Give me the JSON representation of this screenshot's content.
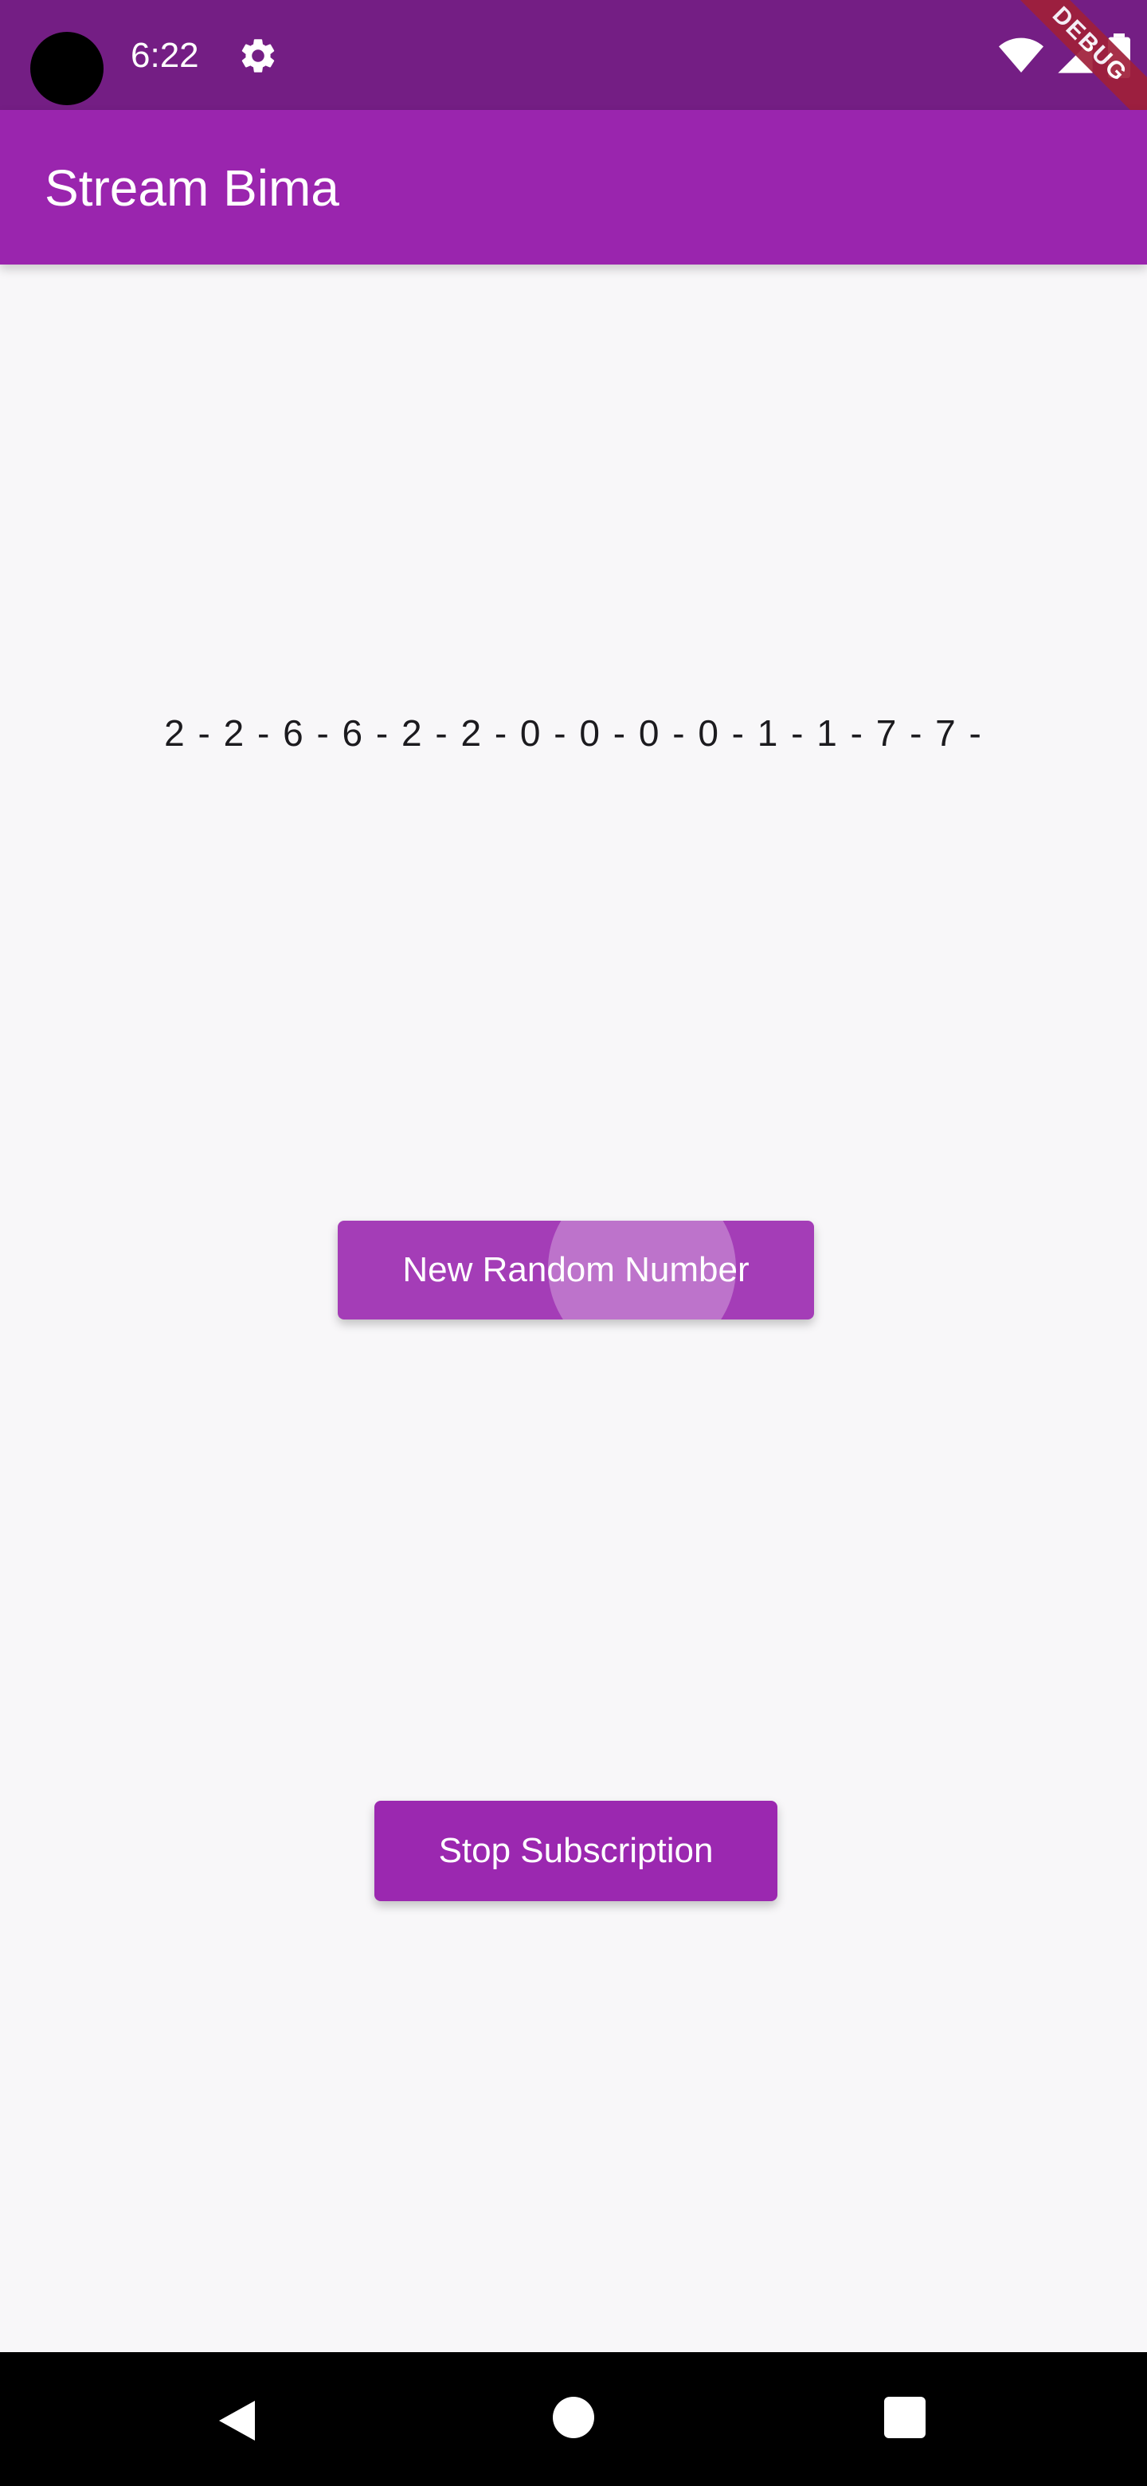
{
  "status_bar": {
    "time": "6:22",
    "icons": [
      "camera-cutout",
      "gear-icon",
      "wifi-icon",
      "signal-icon",
      "battery-icon"
    ],
    "debug_banner": "DEBUG"
  },
  "app_bar": {
    "title": "Stream Bima",
    "color": "#9a25ae"
  },
  "content": {
    "stream_values": "2 - 2 - 6 - 6 - 2 - 2 - 0 - 0 - 0 - 0 - 1 - 1 - 7 - 7 -",
    "new_random_button": "New Random Number",
    "stop_subscription_button": "Stop Subscription"
  },
  "nav_bar": {
    "icons": [
      "back-icon",
      "home-icon",
      "recents-icon"
    ]
  },
  "colors": {
    "status_bar": "#741e84",
    "accent": "#9b28b0",
    "background": "#f8f7f9"
  }
}
